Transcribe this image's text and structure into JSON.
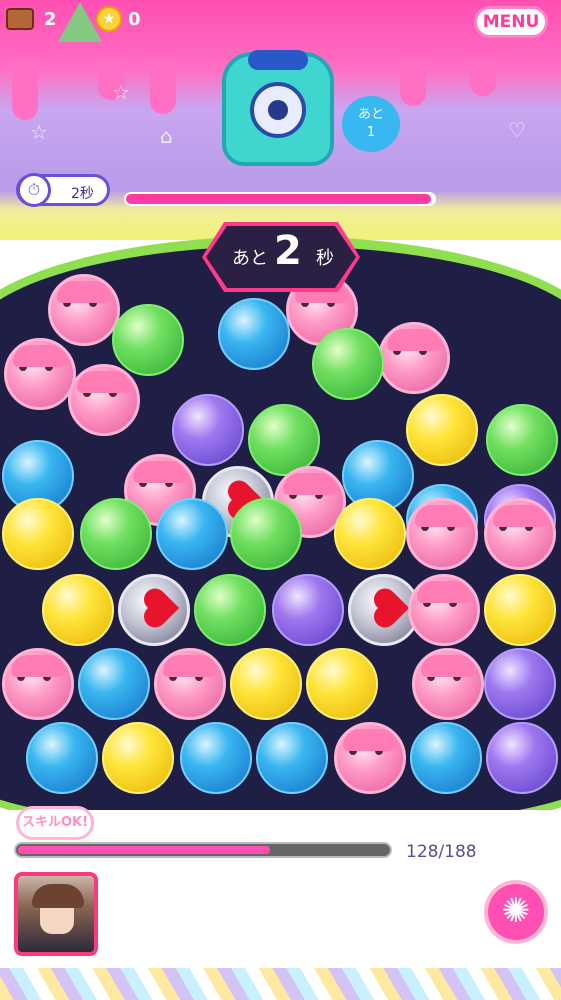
{
  "status_bar": {
    "chest_count": "2",
    "coin_count": "0",
    "menu_label": "MENU"
  },
  "header": {
    "remaining": {
      "prefix": "あと",
      "count": "1"
    },
    "timer_label": "2秒",
    "timer_progress": 0.99
  },
  "countdown": {
    "prefix": "あと",
    "number": "2",
    "suffix": "秒"
  },
  "board": {
    "rows": [
      [
        "pink",
        "",
        "pink",
        "",
        "pink"
      ],
      [
        "pink",
        "green",
        "blue",
        "green",
        "pink"
      ],
      [
        "pink",
        "purple",
        "green",
        "yellow",
        "green"
      ],
      [
        "blue",
        "pink",
        "heart",
        "pink",
        "blue",
        "blue",
        "purple"
      ],
      [
        "yellow",
        "green",
        "blue",
        "green",
        "yellow",
        "pink",
        "pink"
      ],
      [
        "yellow",
        "heart",
        "green",
        "purple",
        "heart",
        "pink",
        "yellow"
      ],
      [
        "pink",
        "blue",
        "pink",
        "yellow",
        "yellow",
        "pink",
        "purple"
      ],
      [
        "blue",
        "yellow",
        "blue",
        "blue",
        "pink",
        "blue",
        "purple"
      ]
    ]
  },
  "footer": {
    "skill_label": "スキルOK!",
    "skill_count": "128/188",
    "skill_progress": 0.68
  },
  "colors": {
    "accent": "#ff4fb2",
    "board_border": "#8fdf4f",
    "board_bg": "#1f1e44"
  },
  "icons": {
    "chest": "treasure-chest-icon",
    "coin": "star-coin-icon",
    "stopwatch": "stopwatch-icon",
    "skill": "pinwheel-icon"
  }
}
